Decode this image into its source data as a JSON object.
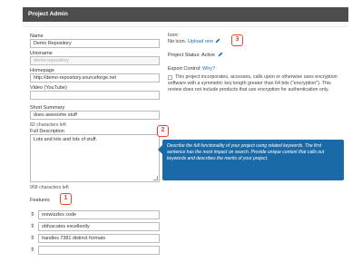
{
  "window": {
    "title": "Project Admin"
  },
  "form": {
    "name": {
      "label": "Name",
      "value": "Demo Repository"
    },
    "unixname": {
      "label": "Unixname",
      "value": "demo-repository"
    },
    "homepage": {
      "label": "Homepage",
      "value": "http://demo-repository.sourceforge.net"
    },
    "video": {
      "label": "Video (YouTube)",
      "value": ""
    },
    "short_summary": {
      "label": "Short Summary",
      "value": "does awesome stuff",
      "chars_left": "82 characters left"
    },
    "full_description": {
      "label": "Full Description",
      "value": "Lots and lots and lots of stuff.",
      "chars_left": "968 characters left"
    },
    "features": {
      "label": "Features",
      "items": [
        "reswizzles code",
        "obfuscates excellently",
        "handles 7381 distinct formats",
        ""
      ]
    }
  },
  "right": {
    "icon_label": "Icon:",
    "icon_status": "No icon.",
    "upload_link": "Upload one",
    "project_status_label": "Project Status:",
    "project_status_value": "Active",
    "export_label": "Export Control:",
    "export_why": "Why?",
    "export_text": "This project incorporates, accesses, calls upon or otherwise uses encryption software with a symmetric key length greater than 64 bits (\"encryption\"). This review does not include products that use encryption for authentication only."
  },
  "tooltip": {
    "text": "Describe the full functionality of your project using related keywords. The first sentence has the most impact on search. Provide unique content that calls out keywords and describes the merits of your project."
  },
  "badges": {
    "one": "1",
    "two": "2",
    "three": "3"
  },
  "colors": {
    "header_bg": "#4d4d4d",
    "tooltip_bg": "#1b6aa8",
    "badge": "#e8452c",
    "link": "#1a6fb5"
  },
  "icons": {
    "drag_handle": "updown-arrow-icon",
    "edit": "pencil-icon"
  }
}
